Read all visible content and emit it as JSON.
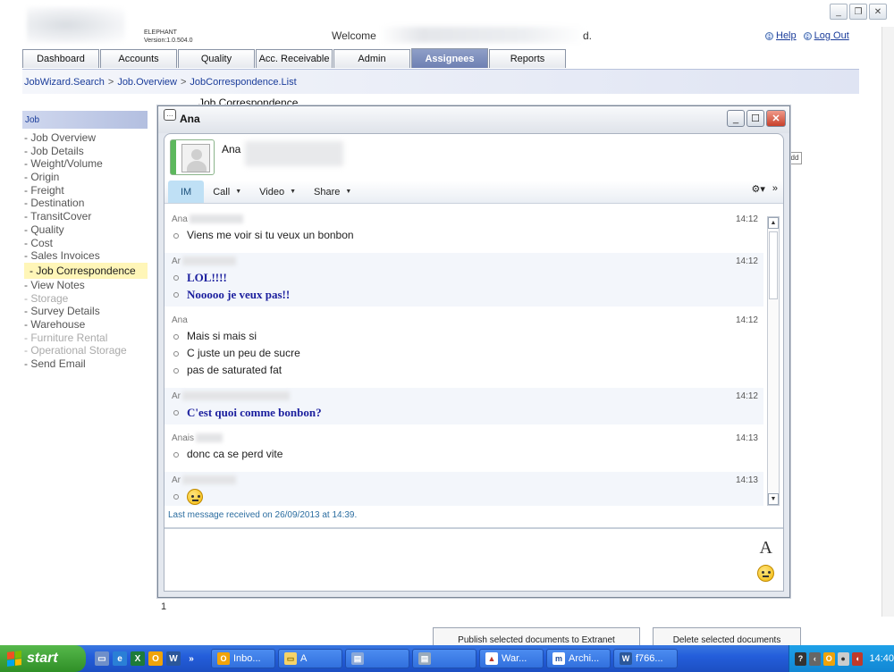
{
  "app": {
    "brand_name": "ELEPHANT",
    "version": "Version:1.0.504.0",
    "welcome": "Welcome",
    "welcome_tail": "d.",
    "help": "Help",
    "logout": "Log Out"
  },
  "tabs": [
    {
      "label": "Dashboard"
    },
    {
      "label": "Accounts"
    },
    {
      "label": "Quality"
    },
    {
      "label": "Acc. Receivable"
    },
    {
      "label": "Admin"
    },
    {
      "label": "Assignees",
      "active": true
    },
    {
      "label": "Reports"
    }
  ],
  "breadcrumb": [
    "JobWizard.Search",
    "Job.Overview",
    "JobCorrespondence.List"
  ],
  "breadcrumb_sep": ">",
  "page_title": "Job Correspondence",
  "sidebar": {
    "heading": "Job",
    "items": [
      {
        "label": "- Job Overview"
      },
      {
        "label": "- Job Details"
      },
      {
        "label": "- Weight/Volume"
      },
      {
        "label": "- Origin"
      },
      {
        "label": "- Freight"
      },
      {
        "label": "- Destination"
      },
      {
        "label": "- TransitCover"
      },
      {
        "label": "- Quality"
      },
      {
        "label": "- Cost"
      },
      {
        "label": "- Sales Invoices"
      },
      {
        "label": "- Job Correspondence",
        "active": true
      },
      {
        "label": "- View Notes"
      },
      {
        "label": "- Storage",
        "disabled": true
      },
      {
        "label": "- Survey Details"
      },
      {
        "label": "- Warehouse"
      },
      {
        "label": "- Furniture Rental",
        "disabled": true
      },
      {
        "label": "- Operational Storage",
        "disabled": true
      },
      {
        "label": "- Send Email"
      }
    ]
  },
  "bg_dd": "dd",
  "page_number": "1",
  "bottom_buttons": [
    "Publish selected documents to Extranet",
    "Delete selected documents"
  ],
  "im": {
    "window_title": "Ana",
    "contact_name": "Ana",
    "toolbar": {
      "im": "IM",
      "call": "Call",
      "video": "Video",
      "share": "Share",
      "more": "»"
    },
    "messages": [
      {
        "sender": "Ana",
        "time": "14:12",
        "style": "normal",
        "lines": [
          "Viens me voir si tu veux un bonbon"
        ]
      },
      {
        "sender": "Ar",
        "time": "14:12",
        "style": "blue",
        "lines": [
          "LOL!!!!",
          "Nooooo je veux pas!!"
        ]
      },
      {
        "sender": "Ana",
        "time": "14:12",
        "style": "normal",
        "lines": [
          "Mais si mais si",
          "C juste un peu de sucre",
          "pas de saturated fat"
        ]
      },
      {
        "sender": "Ar",
        "time": "14:12",
        "style": "blue",
        "lines": [
          "C'est quoi comme bonbon?"
        ]
      },
      {
        "sender": "Anais",
        "time": "14:13",
        "style": "normal",
        "lines": [
          "donc ca se perd vite"
        ]
      },
      {
        "sender": "Ar",
        "time": "14:13",
        "style": "blue",
        "lines": [],
        "emoji": true
      }
    ],
    "last_message": "Last message received on 26/09/2013 at 14:39.",
    "font_button": "A"
  },
  "taskbar": {
    "start": "start",
    "tasks": [
      {
        "label": "Inbo...",
        "icon": "O",
        "color": "#f0a30a"
      },
      {
        "label": "A",
        "icon": "folder",
        "color": "#f5d36a"
      },
      {
        "label": "",
        "icon": "app",
        "color": "#8aa8d8"
      },
      {
        "label": "",
        "icon": "app",
        "color": "#9ab"
      },
      {
        "label": "War...",
        "icon": "pdf",
        "color": "#c0392b"
      },
      {
        "label": "Archi...",
        "icon": "m",
        "color": "#1e4b9a"
      },
      {
        "label": "f766...",
        "icon": "W",
        "color": "#2b579a"
      }
    ],
    "clock": "14:40"
  }
}
